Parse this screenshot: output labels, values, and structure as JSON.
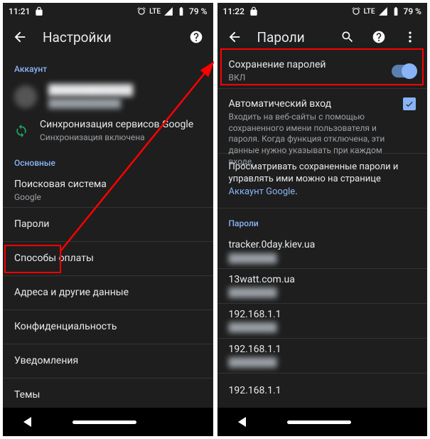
{
  "status": {
    "time_left": "11:21",
    "time_right": "11:22",
    "lte": "LTE",
    "battery": "79 %"
  },
  "left": {
    "title": "Настройки",
    "section_account": "Аккаунт",
    "sync_title": "Синхронизация сервисов Google",
    "sync_sub": "Синхронизация включена",
    "section_main": "Основные",
    "rows": {
      "search_engine_title": "Поисковая система",
      "search_engine_sub": "Google",
      "passwords": "Пароли",
      "payment": "Способы оплаты",
      "addresses": "Адреса и другие данные",
      "privacy": "Конфиденциальность",
      "notifications": "Уведомления",
      "themes": "Темы"
    }
  },
  "right": {
    "title": "Пароли",
    "save_pw_title": "Сохранение паролей",
    "save_pw_sub": "ВКЛ",
    "auto_login_title": "Автоматический вход",
    "auto_login_desc": "Входить на веб-сайты с помощью сохраненного имени пользователя и пароля. Когда функция отключена, эти данные нужно указывать при каждом входе.",
    "view_saved_prefix": "Просматривать сохраненные пароли и управлять ими можно на странице ",
    "view_saved_link": "Аккаунт Google",
    "section_pw": "Пароли",
    "sites": [
      "tracker.0day.kiev.ua",
      "13watt.com.ua",
      "192.168.1.1",
      "192.168.1.1",
      "192.168.1.1"
    ]
  }
}
